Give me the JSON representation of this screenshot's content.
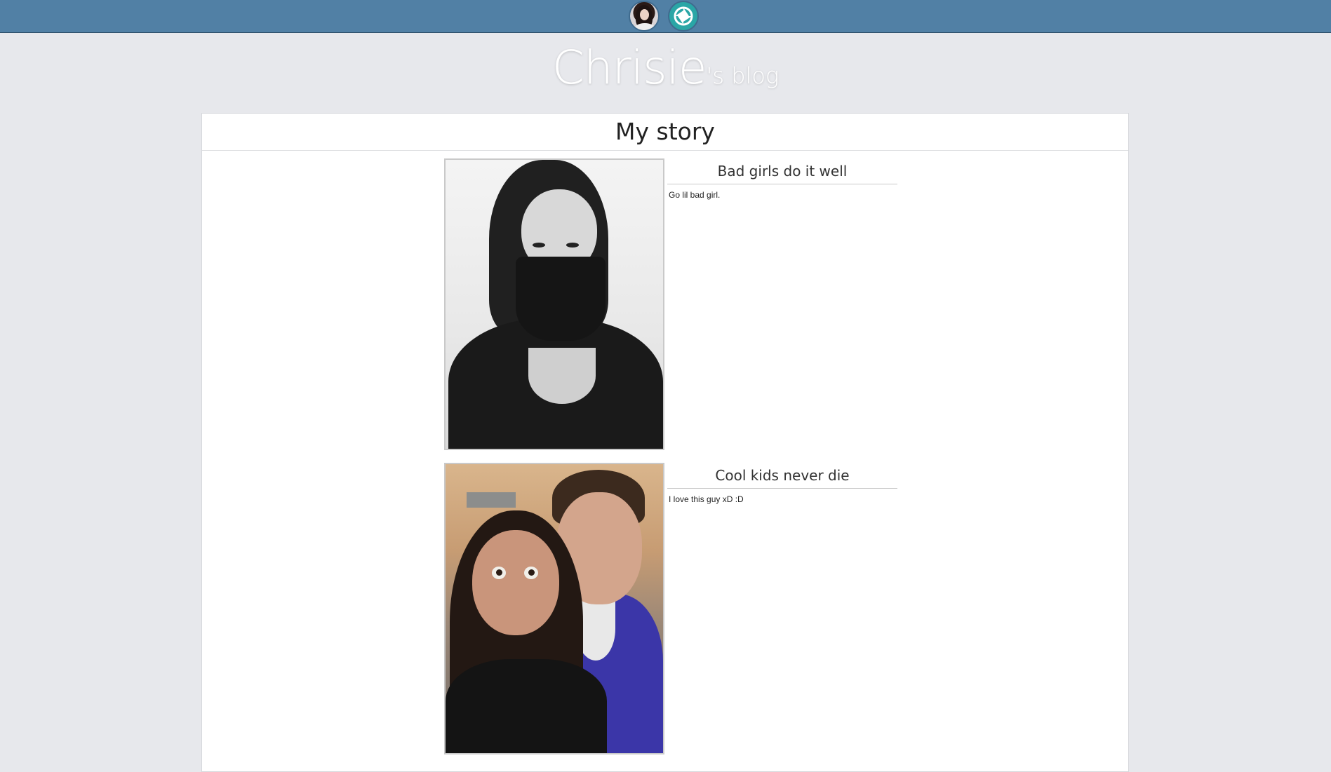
{
  "nav": {
    "icons": [
      "profile-avatar",
      "photos-icon"
    ]
  },
  "blog": {
    "name": "Chrisie",
    "suffix": "'s blog"
  },
  "section": {
    "title": "My story"
  },
  "posts": [
    {
      "title": "Bad girls do it well",
      "body": "Go lil bad girl.",
      "photo": "black-and-white selfie with face covered by scarf"
    },
    {
      "title": "Cool kids never die",
      "body": "I love this guy xD :D",
      "photo": "color selfie of two people"
    }
  ],
  "colors": {
    "topbar": "#5180a5",
    "page_bg": "#e7e8ec",
    "panel_bg": "#ffffff",
    "photos_icon": "#2aa6a6"
  }
}
